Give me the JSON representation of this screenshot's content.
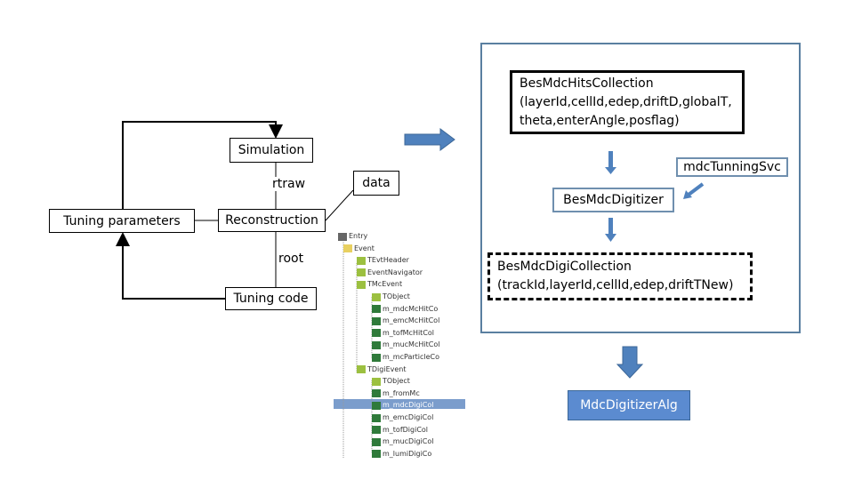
{
  "left": {
    "simulation": "Simulation",
    "rtraw": "rtraw",
    "tuning_parameters": "Tuning  parameters",
    "reconstruction": "Reconstruction",
    "root": "root",
    "tuning_code": "Tuning code",
    "data": "data"
  },
  "right": {
    "hits_collection": [
      "BesMdcHitsCollection",
      "(layerId,cellId,edep,driftD,globalT,",
      "theta,enterAngle,posflag)"
    ],
    "tunning_svc": "mdcTunningSvc",
    "digitizer": "BesMdcDigitizer",
    "digi_collection": [
      "BesMdcDigiCollection",
      "(trackId,layerId,cellId,edep,driftTNew)"
    ],
    "digitizer_alg": "MdcDigitizerAlg"
  },
  "colors": {
    "arrow": "#4f81bd",
    "frame": "#5a7fa0",
    "alg_fill": "#5b8bd0",
    "highlight": "#7b9dcc"
  },
  "tree": {
    "items": [
      {
        "label": "Entry",
        "icon": "tree-icon"
      },
      {
        "label": "Event",
        "icon": "folder-icon"
      },
      {
        "label": "TEvtHeader",
        "icon": "class-icon"
      },
      {
        "label": "EventNavigator",
        "icon": "class-icon"
      },
      {
        "label": "TMcEvent",
        "icon": "class-icon"
      },
      {
        "label": "TObject",
        "icon": "class-icon"
      },
      {
        "label": "m_mdcMcHitCo",
        "icon": "leaf-icon"
      },
      {
        "label": "m_emcMcHitCol",
        "icon": "leaf-icon"
      },
      {
        "label": "m_tofMcHitCol",
        "icon": "leaf-icon"
      },
      {
        "label": "m_mucMcHitCol",
        "icon": "leaf-icon"
      },
      {
        "label": "m_mcParticleCo",
        "icon": "leaf-icon"
      },
      {
        "label": "TDigiEvent",
        "icon": "class-icon"
      },
      {
        "label": "TObject",
        "icon": "class-icon"
      },
      {
        "label": "m_fromMc",
        "icon": "leaf-icon"
      },
      {
        "label": "m_mdcDigiCol",
        "icon": "leaf-icon"
      },
      {
        "label": "m_emcDigiCol",
        "icon": "leaf-icon"
      },
      {
        "label": "m_tofDigiCol",
        "icon": "leaf-icon"
      },
      {
        "label": "m_mucDigiCol",
        "icon": "leaf-icon"
      },
      {
        "label": "m_lumiDigiCo",
        "icon": "leaf-icon"
      }
    ],
    "selected": "m_mdcDigiCol"
  }
}
